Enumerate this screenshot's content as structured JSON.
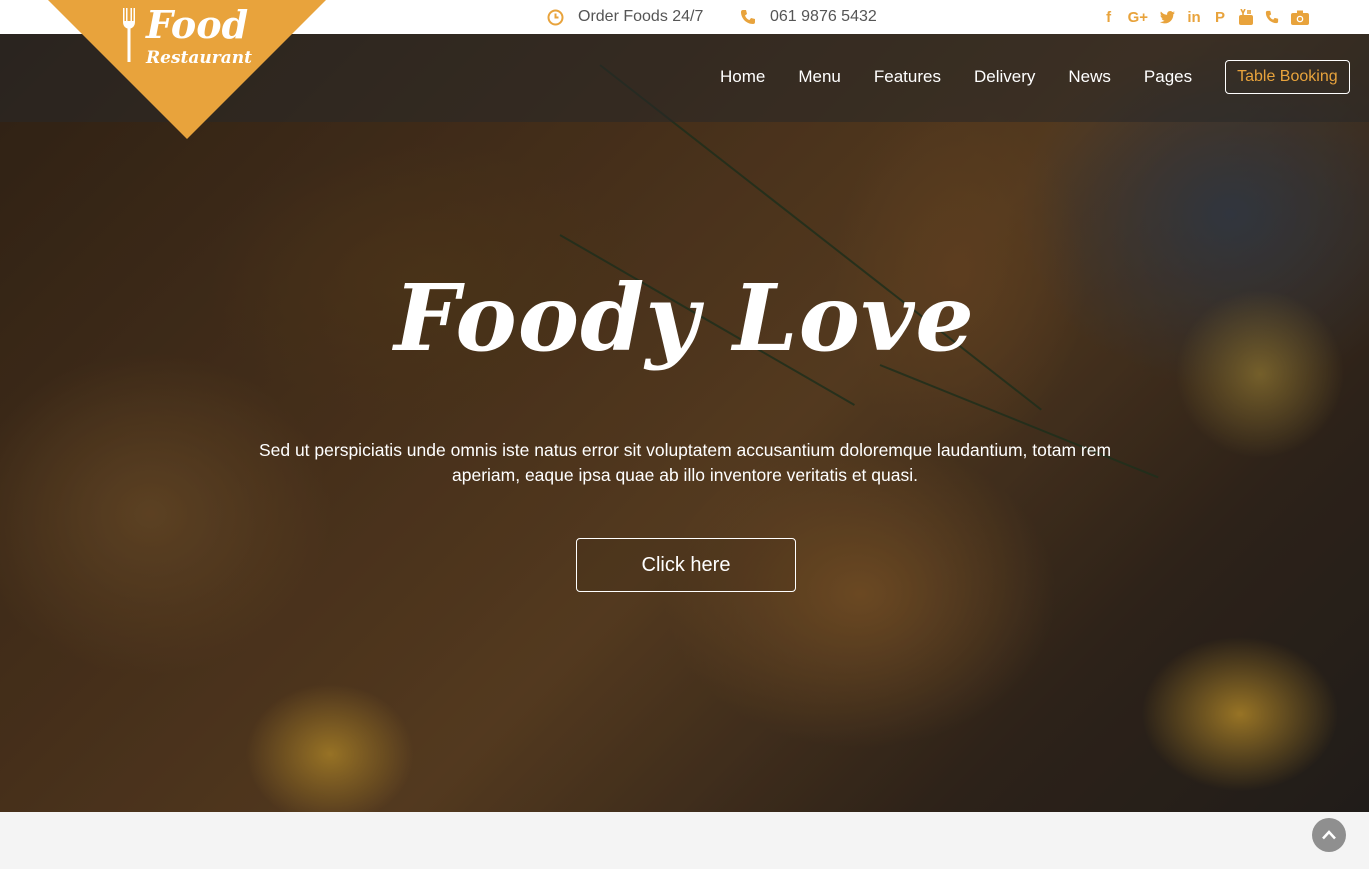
{
  "logo": {
    "word1": "Food",
    "word2": "Restaurant",
    "icon": "fork-icon"
  },
  "topbar": {
    "hours": {
      "icon": "clock-icon",
      "text": "Order Foods 24/7"
    },
    "phone": {
      "icon": "phone-icon",
      "text": "061 9876 5432"
    },
    "socials": [
      {
        "icon": "facebook-icon",
        "glyph": "f"
      },
      {
        "icon": "google-plus-icon",
        "glyph": "G+"
      },
      {
        "icon": "twitter-icon",
        "glyph": "🐦"
      },
      {
        "icon": "linkedin-icon",
        "glyph": "in"
      },
      {
        "icon": "pinterest-icon",
        "glyph": "P"
      },
      {
        "icon": "youtube-icon",
        "glyph": "▶"
      },
      {
        "icon": "phone-icon",
        "glyph": "✆"
      },
      {
        "icon": "camera-icon",
        "glyph": "📷"
      }
    ]
  },
  "nav": {
    "home": "Home",
    "menu": "Menu",
    "features": "Features",
    "delivery": "Delivery",
    "news": "News",
    "pages": "Pages",
    "booking": "Table Booking"
  },
  "hero": {
    "title": "Foody Love",
    "text": "Sed ut perspiciatis unde omnis iste natus error sit voluptatem accusantium doloremque laudantium, totam rem aperiam, eaque ipsa quae ab illo inventore veritatis et quasi.",
    "button": "Click here"
  },
  "colors": {
    "accent": "#e8a33c"
  }
}
